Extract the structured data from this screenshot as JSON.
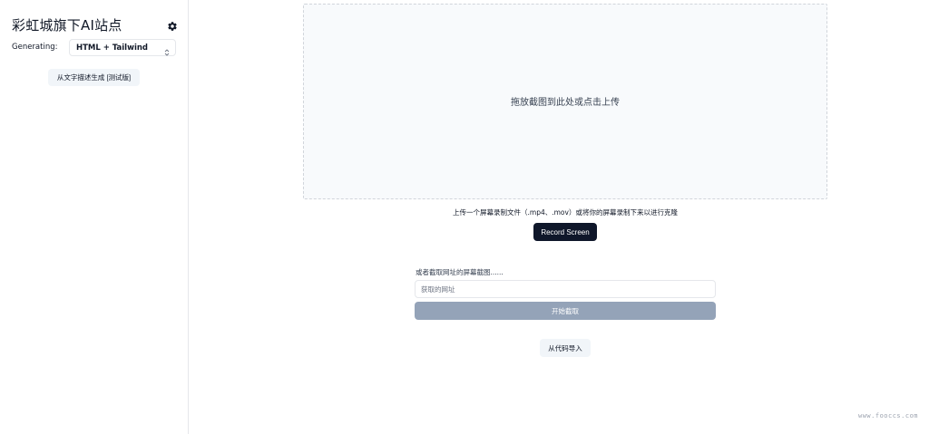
{
  "sidebar": {
    "title": "彩虹城旗下AI站点",
    "generating_label": "Generating:",
    "stack_value": "HTML + Tailwind",
    "text_generate_button": "从文字描述生成 [测试版]"
  },
  "main": {
    "dropzone_text": "拖放截图到此处或点击上传",
    "video_hint": "上传一个屏幕录制文件（.mp4、.mov）或将你的屏幕录制下来以进行克隆",
    "record_button": "Record Screen",
    "url_label": "或者截取网址的屏幕截图......",
    "url_placeholder": "获取的网址",
    "capture_button": "开始截取",
    "import_button": "从代码导入"
  },
  "watermark": "www.fooccs.com",
  "icons": {
    "settings": "gear-icon",
    "select": "chevron-up-down-icon"
  },
  "colors": {
    "record_button_bg": "#0f172a",
    "capture_button_bg": "#94a3b8",
    "secondary_button_bg": "#f1f5f9",
    "dropzone_bg": "#f8fafc"
  }
}
